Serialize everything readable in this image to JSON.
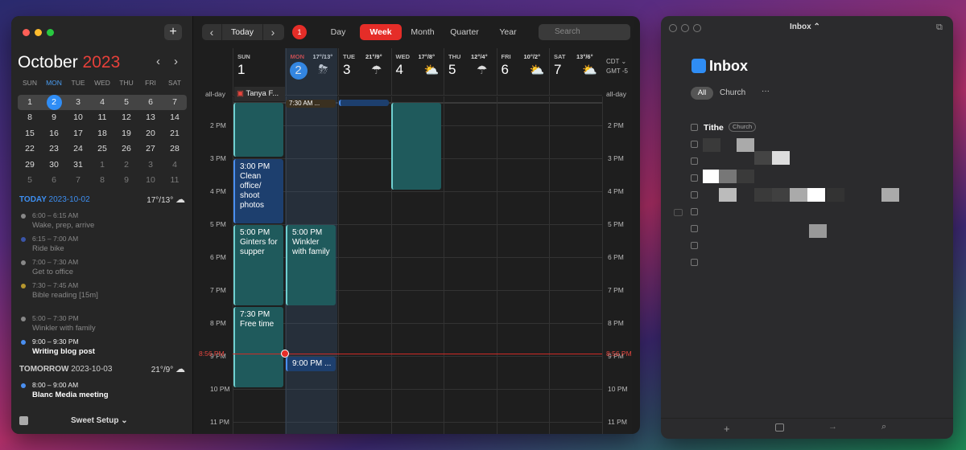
{
  "sidebar": {
    "add_label": "+",
    "month": "October",
    "year": "2023",
    "prev": "‹",
    "next": "›",
    "weekdays": [
      "SUN",
      "MON",
      "TUE",
      "WED",
      "THU",
      "FRI",
      "SAT"
    ],
    "weeks": [
      [
        "1",
        "2",
        "3",
        "4",
        "5",
        "6",
        "7"
      ],
      [
        "8",
        "9",
        "10",
        "11",
        "12",
        "13",
        "14"
      ],
      [
        "15",
        "16",
        "17",
        "18",
        "19",
        "20",
        "21"
      ],
      [
        "22",
        "23",
        "24",
        "25",
        "26",
        "27",
        "28"
      ],
      [
        "29",
        "30",
        "31",
        "1",
        "2",
        "3",
        "4"
      ],
      [
        "5",
        "6",
        "7",
        "8",
        "9",
        "10",
        "11"
      ]
    ],
    "today_label": "TODAY",
    "today_date": "2023-10-02",
    "today_weather": "17°/13°",
    "tomorrow_label": "TOMORROW",
    "tomorrow_date": "2023-10-03",
    "tomorrow_weather": "21°/9°",
    "events": [
      {
        "time": "6:00 – 6:15 AM",
        "name": "Wake, prep, arrive",
        "color": "#888888",
        "hi": false
      },
      {
        "time": "6:15 – 7:00 AM",
        "name": "Ride bike",
        "color": "#3a55a8",
        "hi": false
      },
      {
        "time": "7:00 – 7:30 AM",
        "name": "Get to office",
        "color": "#888888",
        "hi": false
      },
      {
        "time": "7:30 – 7:45 AM",
        "name": "Bible reading [15m]",
        "color": "#b5962e",
        "hi": false
      },
      {
        "time": "5:00 – 7:30 PM",
        "name": "Winkler with family",
        "color": "#888888",
        "hi": false
      },
      {
        "time": "9:00 – 9:30 PM",
        "name": "Writing blog post",
        "color": "#4a8ff0",
        "hi": true
      }
    ],
    "tomorrow_events": [
      {
        "time": "8:00 – 9:00 AM",
        "name": "Blanc Media meeting",
        "color": "#4a8ff0",
        "hi": true
      }
    ],
    "footer": "Sweet Setup ⌄"
  },
  "toolbar": {
    "prev": "‹",
    "today": "Today",
    "next": "›",
    "badge": "1",
    "views": [
      "Day",
      "Week",
      "Month",
      "Quarter",
      "Year"
    ],
    "search_placeholder": "Search"
  },
  "days": [
    {
      "dow": "SUN",
      "num": "1",
      "weather": "",
      "icon": ""
    },
    {
      "dow": "MON",
      "num": "2",
      "weather": "17°/13°",
      "icon": "⛈"
    },
    {
      "dow": "TUE",
      "num": "3",
      "weather": "21°/9°",
      "icon": "☂"
    },
    {
      "dow": "WED",
      "num": "4",
      "weather": "17°/8°",
      "icon": "⛅"
    },
    {
      "dow": "THU",
      "num": "5",
      "weather": "12°/4°",
      "icon": "☂"
    },
    {
      "dow": "FRI",
      "num": "6",
      "weather": "10°/2°",
      "icon": "⛅"
    },
    {
      "dow": "SAT",
      "num": "7",
      "weather": "13°/6°",
      "icon": "⛅"
    }
  ],
  "timezone": {
    "abbr": "CDT ⌄",
    "offset": "GMT -5"
  },
  "allday": {
    "label": "all-day",
    "event": "Tanya F..."
  },
  "hours": [
    "2 PM",
    "3 PM",
    "4 PM",
    "5 PM",
    "6 PM",
    "7 PM",
    "8 PM",
    "9 PM",
    "10 PM",
    "11 PM"
  ],
  "now": "8:56 PM",
  "blocks": {
    "top_mon": "7:30 AM ...",
    "clean": "3:00 PM\nClean office/ shoot photos",
    "ginters": "5:00 PM\nGinters for supper",
    "winkler": "5:00 PM\nWinkler with family",
    "free": "7:30 PM\nFree time",
    "blog": "9:00 PM ..."
  },
  "inbox": {
    "title": "Inbox ⌃",
    "heading": "Inbox",
    "filters": [
      "All",
      "Church"
    ],
    "more": "···",
    "first_task": "Tithe",
    "first_tag": "Church"
  }
}
